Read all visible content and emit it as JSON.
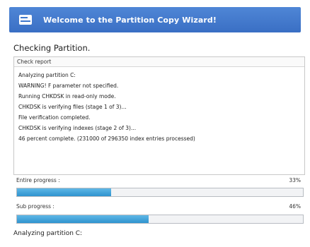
{
  "banner": {
    "title": "Welcome to the Partition Copy Wizard!",
    "icon": "partition-disk-icon",
    "background_color": "#3f78cc"
  },
  "section_title": "Checking Partition.",
  "report": {
    "header": "Check report",
    "lines": [
      "Analyzing partition C:",
      "WARNING!  F parameter not specified.",
      "Running CHKDSK in read-only mode.",
      "CHKDSK is verifying files (stage 1 of 3)...",
      "File verification completed.",
      "CHKDSK is verifying indexes (stage 2 of 3)...",
      "46 percent complete. (231000 of 296350 index entries processed)"
    ]
  },
  "entire_progress": {
    "label": "Entire progress :",
    "percent_text": "33%",
    "fraction": 0.33
  },
  "sub_progress": {
    "label": "Sub progress :",
    "percent_text": "46%",
    "fraction": 0.46
  },
  "progress_color": "#3a9bd5",
  "status": "Analyzing partition C:"
}
